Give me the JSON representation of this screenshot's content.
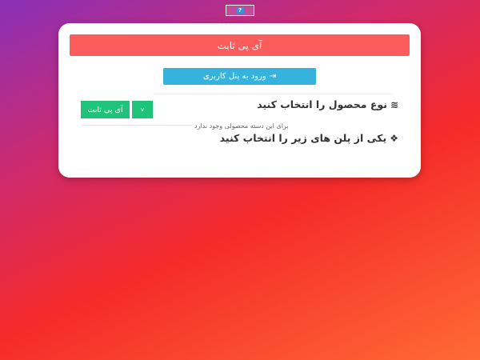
{
  "top_badge": {
    "icon": "question-icon",
    "glyph": "?"
  },
  "card": {
    "header_title": "آی پی ثابت",
    "login_button": {
      "icon": "sign-in-icon",
      "glyph": "⇥",
      "label": "ورود به پنل کاربری"
    },
    "product_type": {
      "icon": "layers-icon",
      "glyph": "≋",
      "title": "نوع محصول را انتخاب کنید",
      "selected_product": "آی پی ثابت",
      "dropdown_glyph": "˅",
      "empty_note": "برای این دسته محصولی وجود ندارد"
    },
    "plan_select": {
      "icon": "cubes-icon",
      "glyph": "❖",
      "title": "یکی از پلن های زیر را انتخاب کنید"
    }
  },
  "colors": {
    "header": "#fd5c5c",
    "login_button": "#36b3dc",
    "product_button": "#1fc37a"
  }
}
